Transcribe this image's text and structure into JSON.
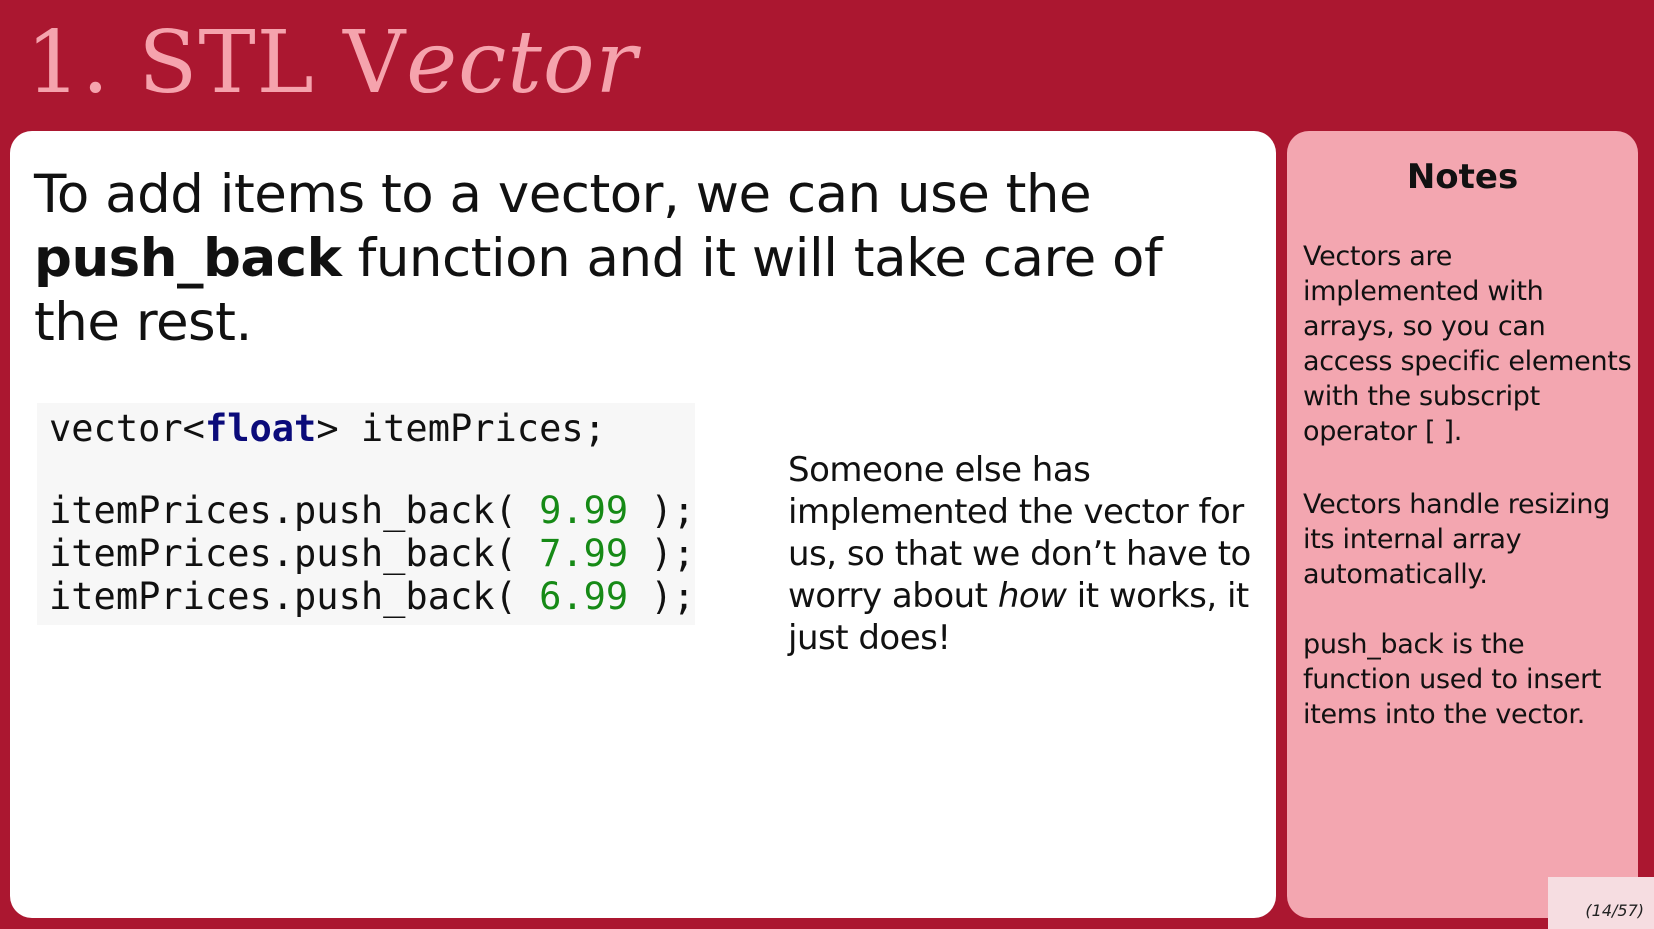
{
  "title": {
    "number": "1.",
    "plain": "STL V",
    "italic": "ector"
  },
  "intro": {
    "before": "To add items to a vector, we can use the ",
    "bold": "push_back",
    "after": " function and it will take care of the rest."
  },
  "code": {
    "declaration": {
      "prefix": "vector<",
      "keyword": "float",
      "suffix": "> itemPrices;"
    },
    "calls": [
      {
        "prefix": "itemPrices.push_back( ",
        "value": "9.99",
        "suffix": " );"
      },
      {
        "prefix": "itemPrices.push_back( ",
        "value": "7.99",
        "suffix": " );"
      },
      {
        "prefix": "itemPrices.push_back( ",
        "value": "6.99",
        "suffix": " );"
      }
    ]
  },
  "side_note": {
    "before": "Someone else has implemented the vector for us, so that we don’t have to worry about ",
    "italic": "how",
    "after": " it works, it just does!"
  },
  "notes": {
    "title": "Notes",
    "paragraphs": [
      "Vectors are implemented with arrays, so you can access specific elements with the subscript operator [ ].",
      "Vectors handle resizing its internal array automatically.",
      "push_back is the function used to insert items into the vector."
    ]
  },
  "page_counter": "(14/57)",
  "colors": {
    "background": "#ab1730",
    "title": "#f5a3ad",
    "notes_panel": "#f3a6b0",
    "code_keyword": "#0b0b7a",
    "code_number": "#168a16"
  }
}
